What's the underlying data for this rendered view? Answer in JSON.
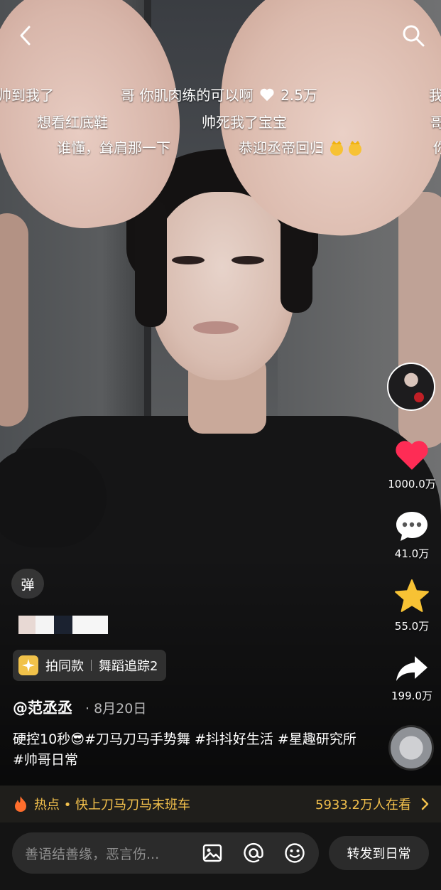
{
  "danmaku": [
    {
      "text": "帅到我了"
    },
    {
      "text": "哥 你肌肉练的可以啊"
    },
    {
      "text": "2.5万"
    },
    {
      "text": "我"
    },
    {
      "text": "想看红底鞋"
    },
    {
      "text": "帅死我了宝宝"
    },
    {
      "text": "哥"
    },
    {
      "text": "谁懂，耸肩那一下"
    },
    {
      "text": "恭迎丞帝回归"
    },
    {
      "text": "你"
    }
  ],
  "rail": {
    "like_count": "1000.0万",
    "comment_count": "41.0万",
    "favorite_count": "55.0万",
    "share_count": "199.0万"
  },
  "dan_label": "弹",
  "pill": {
    "primary": "拍同款",
    "secondary": "舞蹈追踪2"
  },
  "author": "@范丞丞",
  "date": "· 8月20日",
  "caption": {
    "emoji": "😎",
    "prefix": "硬控10秒",
    "tags": "#刀马刀马手势舞 #抖抖好生活 #星趣研究所 #帅哥日常"
  },
  "hotbar": {
    "text": "热点 • 快上刀马刀马末班车",
    "count": "5933.2万人在看"
  },
  "input": {
    "placeholder": "善语结善缘，恶言伤..."
  },
  "share_button": "转发到日常",
  "colors": {
    "like": "#fe2c55",
    "star": "#f7c234",
    "hot": "#f2c04c"
  }
}
